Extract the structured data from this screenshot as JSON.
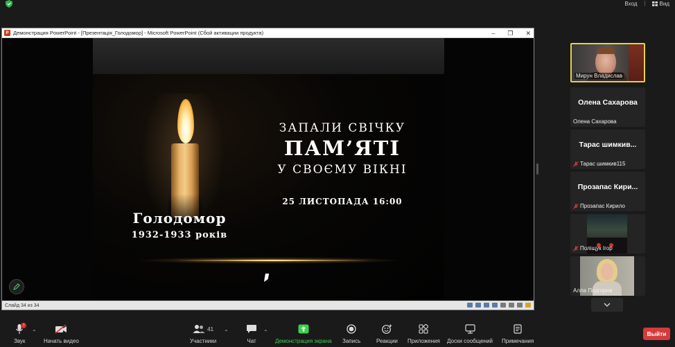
{
  "topbar": {
    "enter_label": "Вход",
    "view_label": "Вид"
  },
  "ppt": {
    "window_title": "Демонстрация PowerPoint - [Презентація_Голодомор] - Microsoft PowerPoint (Сбой активации продукта)",
    "logo_letter": "P",
    "status_text": "Слайд 34 из 34",
    "controls": {
      "minimize": "–",
      "restore": "❐",
      "close": "✕"
    }
  },
  "slide": {
    "line_light": "ЗАПАЛИ СВІЧКУ",
    "line_memory": "ПАМ’ЯТІ",
    "line_window": "У СВОЄМУ ВІКНІ",
    "date": "25 ЛИСТОПАДА 16:00",
    "golodomor": "Голодомор",
    "years": "1932-1933 років"
  },
  "participants": [
    {
      "name": "Мирун Владислав",
      "type": "video",
      "active": true
    },
    {
      "display": "Олена Сахарова",
      "name": "Олена Сахарова",
      "muted": false
    },
    {
      "display": "Тарас шимкив...",
      "name": "Тарас шимкив115",
      "muted": true
    },
    {
      "display": "Прозапас Кири...",
      "name": "Прозапас Кирило",
      "muted": true
    },
    {
      "name": "Поліщук Ігор",
      "type": "video-car",
      "muted": true
    },
    {
      "name": "Алла Подгорна",
      "type": "video-woman",
      "muted": false
    }
  ],
  "toolbar": {
    "mic_label": "Звук",
    "mic_badge": "!",
    "video_label": "Начать видео",
    "participants_label": "Участники",
    "participants_count": "41",
    "chat_label": "Чат",
    "share_label": "Демонстрация экрана",
    "record_label": "Запись",
    "reactions_label": "Реакции",
    "apps_label": "Приложения",
    "whiteboard_label": "Доски сообщений",
    "notes_label": "Примечания",
    "leave_label": "Выйти"
  },
  "colors": {
    "background": "#1a1a1a",
    "active_speaker": "#e5d24a",
    "share_green": "#3ccf4e",
    "leave_red": "#d73a3a",
    "mute_red": "#e03a3a"
  }
}
